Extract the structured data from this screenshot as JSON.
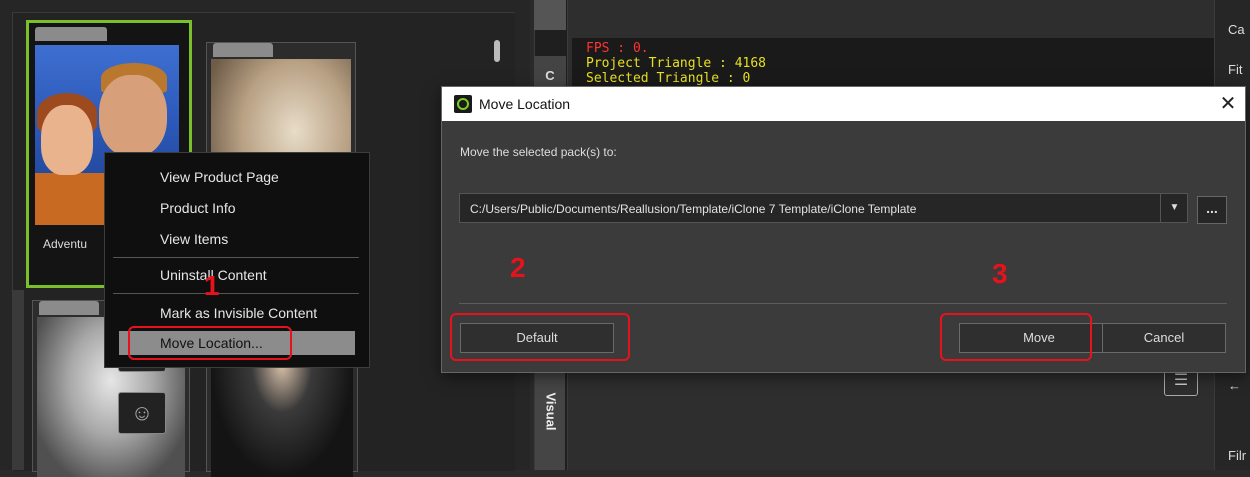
{
  "library": {
    "card_label": "Adventu"
  },
  "context_menu": {
    "items": [
      "View Product Page",
      "Product Info",
      "View Items",
      "Uninstall Content",
      "Mark as Invisible Content",
      "Move Location..."
    ]
  },
  "vertical_tabs": {
    "top_letter": "C",
    "visual": "Visual"
  },
  "viewport": {
    "stats": {
      "fps": "FPS : 0.",
      "project_triangle": "Project Triangle : 4168",
      "selected_triangle": "Selected Triangle : 0"
    },
    "stat_colors": {
      "fps": "#ff3333",
      "triangles": "#e8e020"
    }
  },
  "right_panel": {
    "labels": [
      "Ca",
      "Fit",
      "Filr"
    ],
    "arrow": "←"
  },
  "dialog": {
    "title": "Move Location",
    "close_glyph": "✕",
    "prompt": "Move the selected pack(s) to:",
    "path": "C:/Users/Public/Documents/Reallusion/Template/iClone 7 Template/iClone Template",
    "dropdown_glyph": "▼",
    "browse_label": "...",
    "default_label": "Default",
    "move_label": "Move",
    "cancel_label": "Cancel"
  },
  "annotations": {
    "step1": "1",
    "step2": "2",
    "step3": "3",
    "color": "#e8121c"
  },
  "icons": {
    "chat": "chat-bubble-icon",
    "app": "iclone-logo-icon"
  }
}
